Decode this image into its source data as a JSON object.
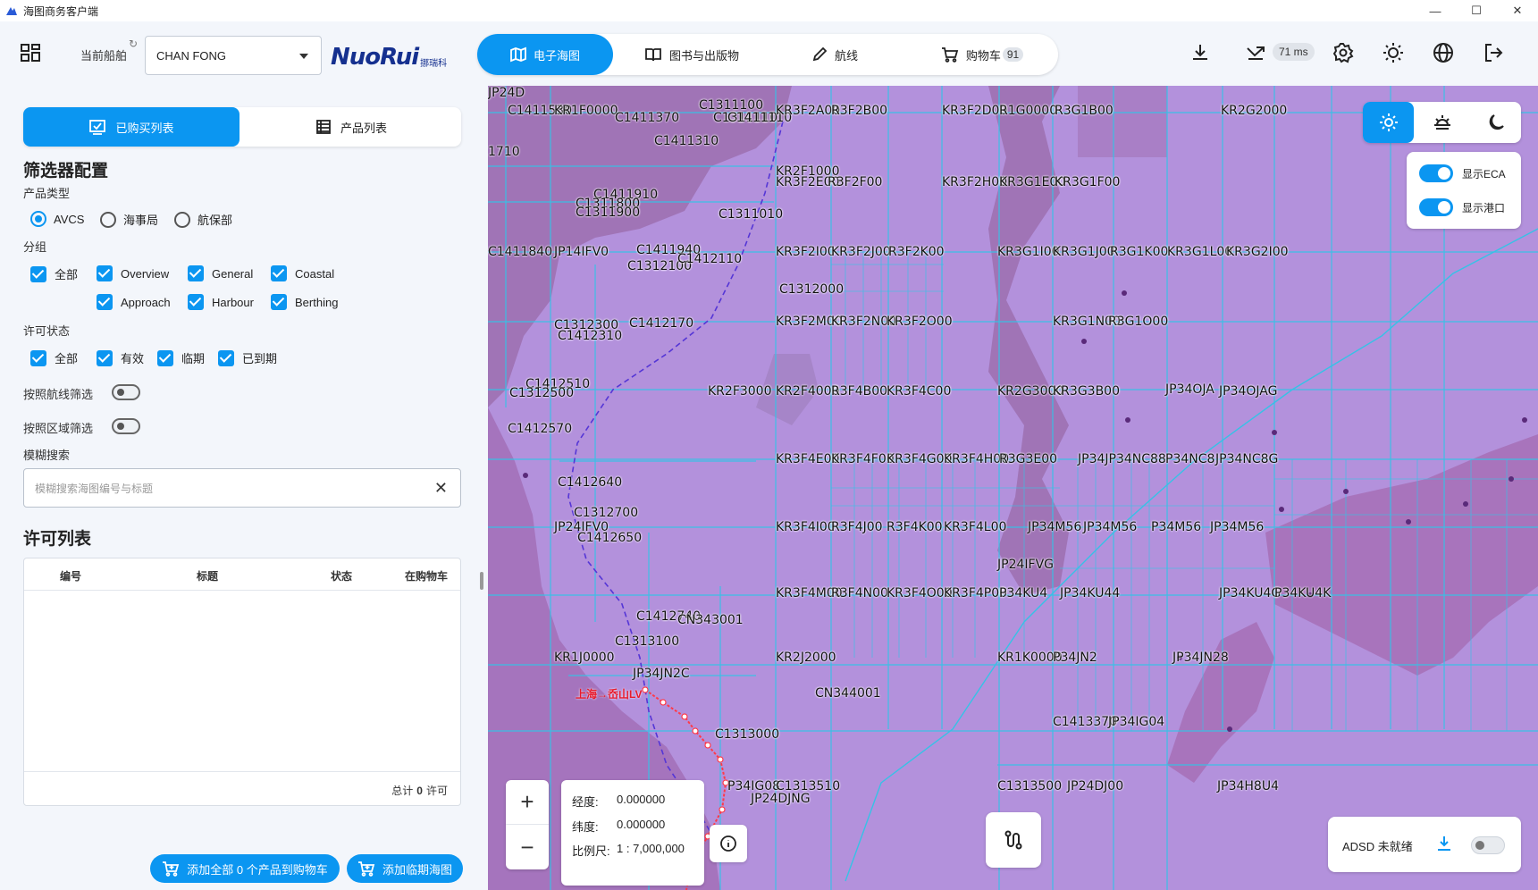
{
  "window": {
    "title": "海图商务客户端",
    "controls": [
      "—",
      "☐",
      "✕"
    ]
  },
  "toolbar": {
    "ship_label": "当前船舶",
    "ship_value": "CHAN FONG",
    "logo_text": "NuoRui",
    "logo_sub": "挪瑞科",
    "tabs": [
      {
        "label": "电子海图",
        "icon": "map-icon"
      },
      {
        "label": "图书与出版物",
        "icon": "book-icon"
      },
      {
        "label": "航线",
        "icon": "pencil-icon"
      },
      {
        "label": "购物车",
        "icon": "cart-icon",
        "badge": "91"
      }
    ],
    "latency": "71 ms"
  },
  "left": {
    "tabs": [
      "已购买列表",
      "产品列表"
    ],
    "filter_title": "筛选器配置",
    "product_type_label": "产品类型",
    "product_types": [
      "AVCS",
      "海事局",
      "航保部"
    ],
    "group_label": "分组",
    "groups_row1": [
      "全部",
      "Overview",
      "General",
      "Coastal"
    ],
    "groups_row2": [
      "Approach",
      "Harbour",
      "Berthing"
    ],
    "license_status_label": "许可状态",
    "license_status": [
      "全部",
      "有效",
      "临期",
      "已到期"
    ],
    "filter_by_route": "按照航线筛选",
    "filter_by_area": "按照区域筛选",
    "fuzzy_label": "模糊搜索",
    "search_placeholder": "模糊搜索海图编号与标题",
    "license_list_title": "许可列表",
    "columns": [
      "编号",
      "标题",
      "状态",
      "在购物车"
    ],
    "total_prefix": "总计",
    "total_count": "0",
    "total_suffix": "许可",
    "btn_add_all": "添加全部 0 个产品到购物车",
    "btn_add_expiring": "添加临期海图"
  },
  "map": {
    "mode_buttons": [
      "day-icon",
      "dusk-icon",
      "night-icon"
    ],
    "layer_eca": "显示ECA",
    "layer_ports": "显示港口",
    "coord": {
      "lon_label": "经度:",
      "lon": "0.000000",
      "lat_label": "纬度:",
      "lat": "0.000000",
      "scale_label": "比例尺:",
      "scale": "1 : 7,000,000"
    },
    "route_label": "上海→岙山LV",
    "adsd_label": "ADSD 未就绪",
    "chart_labels": [
      "C1411530",
      "KR1F0000",
      "C1411370",
      "C1311100",
      "C1311110",
      "C1411110",
      "KR3F2A00",
      "R3F2B00",
      "KR3F2D00",
      "R1G0000",
      "R3G1B00",
      "KR2G2000",
      "1710",
      "C1411310",
      "KR2F1000",
      "KR3F2E00",
      "R3F2F00",
      "KR3F2H00",
      "KR3G1E00",
      "KR3G1F00",
      "C1411910",
      "C1311800",
      "C1311900",
      "C1311010",
      "C1411840",
      "JP14IFV0",
      "C1411940",
      "C1312100",
      "C1412110",
      "KR3F2I00",
      "KR3F2J00",
      "R3F2K00",
      "KR3G1I00",
      "KR3G1J00",
      "R3G1K00",
      "KR3G1L00",
      "KR3G2I00",
      "C1312000",
      "C1312300",
      "C1412170",
      "C1412310",
      "KR3F2M00",
      "KR3F2N00",
      "KR3F2O00",
      "KR3G1N00",
      "R3G1O00",
      "C1412510",
      "C1312500",
      "KR2F3000",
      "KR2F4000",
      "R3F4B00",
      "KR3F4C00",
      "KR2G3000",
      "KR3G3B00",
      "JP34OJA",
      "JP34OJAG",
      "C1412570",
      "KR3F4E00",
      "KR3F4F00",
      "KR3F4G00",
      "KR3F4H00",
      "R3G3E00",
      "JP34JP34NC88",
      "P34NC8",
      "JP34NC8G",
      "C1412640",
      "C1312700",
      "JP24IFV0",
      "C1412650",
      "KR3F4I00",
      "R3F4J00",
      "R3F4K00",
      "KR3F4L00",
      "JP34M56",
      "JP34M56",
      "P34M56",
      "JP34M56",
      "JP24IFVG",
      "KR3F4M00",
      "R3F4N00",
      "KR3F4O00",
      "KR3F4P00",
      "P34KU4",
      "JP34KU44",
      "JP34KU4G",
      "P34KU4K",
      "C1412740",
      "CN343001",
      "C1313100",
      "KR1J0000",
      "KR2J2000",
      "KR1K0000",
      "P34JN2",
      "JP34JN28",
      "JP34JN2C",
      "CN344001",
      "C1313000",
      "C1413370",
      "JP34IG04",
      "P34IG08",
      "C1313510",
      "JP24DJNG",
      "C1313500",
      "JP24DJ00",
      "JP34H8U4",
      "JP24D"
    ]
  }
}
